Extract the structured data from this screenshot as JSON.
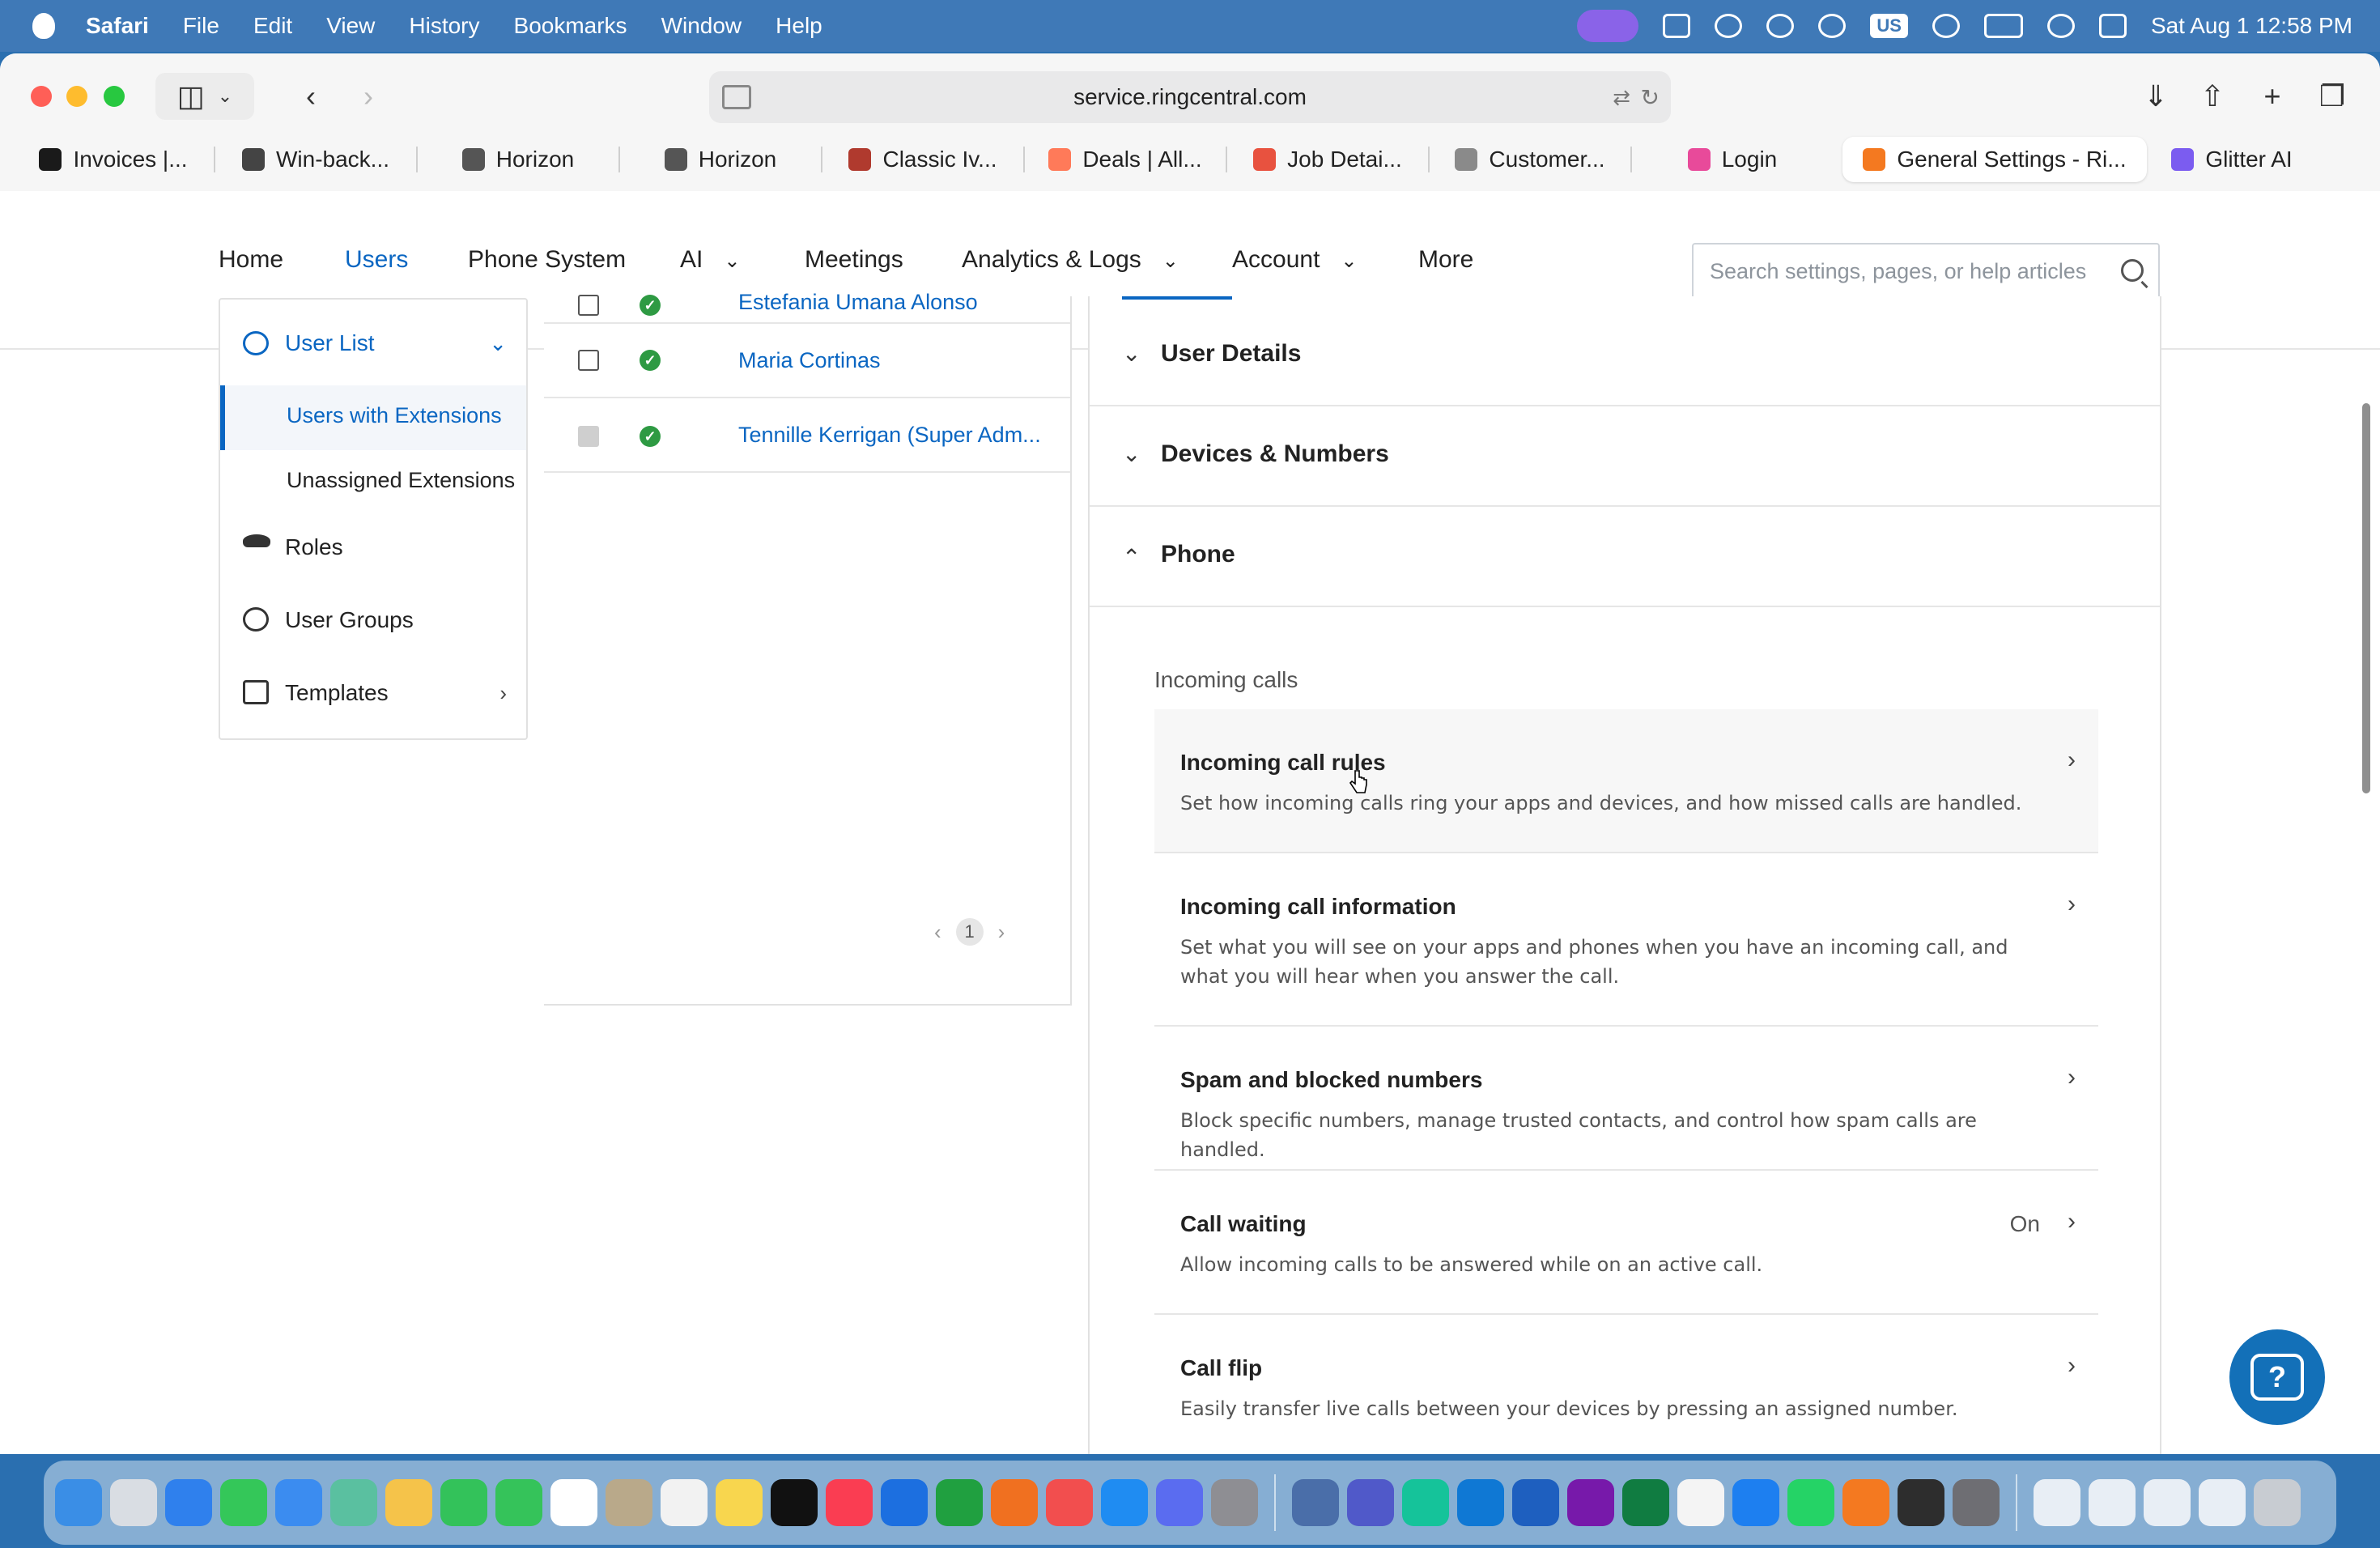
{
  "menubar": {
    "app": "Safari",
    "items": [
      "File",
      "Edit",
      "View",
      "History",
      "Bookmarks",
      "Window",
      "Help"
    ],
    "input_source": "US",
    "datetime": "Sat Aug 1  12:58 PM"
  },
  "browser": {
    "url": "service.ringcentral.com",
    "tabs": [
      {
        "label": "Invoices |...",
        "color": "#1a1a1a"
      },
      {
        "label": "Win-back...",
        "color": "#444444"
      },
      {
        "label": "Horizon",
        "color": "#555555"
      },
      {
        "label": "Horizon",
        "color": "#555555"
      },
      {
        "label": "Classic Iv...",
        "color": "#b03a2e"
      },
      {
        "label": "Deals | All...",
        "color": "#ff7a59"
      },
      {
        "label": "Job Detai...",
        "color": "#e8523f"
      },
      {
        "label": "Customer...",
        "color": "#8a8a8a"
      },
      {
        "label": "Login",
        "color": "#e84a9a"
      },
      {
        "label": "General Settings - Ri...",
        "color": "#f47920"
      },
      {
        "label": "Glitter AI",
        "color": "#7b5cf0"
      }
    ]
  },
  "appnav": {
    "items": [
      {
        "label": "Home"
      },
      {
        "label": "Users"
      },
      {
        "label": "Phone System"
      },
      {
        "label": "AI"
      },
      {
        "label": "Meetings"
      },
      {
        "label": "Analytics & Logs"
      },
      {
        "label": "Account"
      },
      {
        "label": "More"
      }
    ],
    "search_placeholder": "Search settings, pages, or help articles"
  },
  "leftmenu": {
    "user_list": "User List",
    "users_with_extensions": "Users with Extensions",
    "unassigned_extensions": "Unassigned Extensions",
    "roles": "Roles",
    "user_groups": "User Groups",
    "templates": "Templates"
  },
  "users": {
    "rows": [
      {
        "name": "Estefania Umana Alonso"
      },
      {
        "name": "Maria Cortinas"
      },
      {
        "name": "Tennille Kerrigan (Super Adm..."
      }
    ],
    "page": "1"
  },
  "details": {
    "sections": [
      "User Details",
      "Devices & Numbers",
      "Phone"
    ],
    "incoming_label": "Incoming calls",
    "cards": [
      {
        "title": "Incoming call rules",
        "desc": "Set how incoming calls ring your apps and devices, and how missed calls are handled.",
        "value": ""
      },
      {
        "title": "Incoming call information",
        "desc": "Set what you will see on your apps and phones when you have an incoming call, and what you will hear when you answer the call.",
        "value": ""
      },
      {
        "title": "Spam and blocked numbers",
        "desc": "Block specific numbers, manage trusted contacts, and control how spam calls are handled.",
        "value": ""
      },
      {
        "title": "Call waiting",
        "desc": "Allow incoming calls to be answered while on an active call.",
        "value": "On"
      },
      {
        "title": "Call flip",
        "desc": "Easily transfer live calls between your devices by pressing an assigned number.",
        "value": ""
      }
    ]
  },
  "colors": {
    "accent": "#0a66c2",
    "status_ok": "#2e9a43"
  },
  "icons": {
    "chat": "help-chat-icon"
  }
}
